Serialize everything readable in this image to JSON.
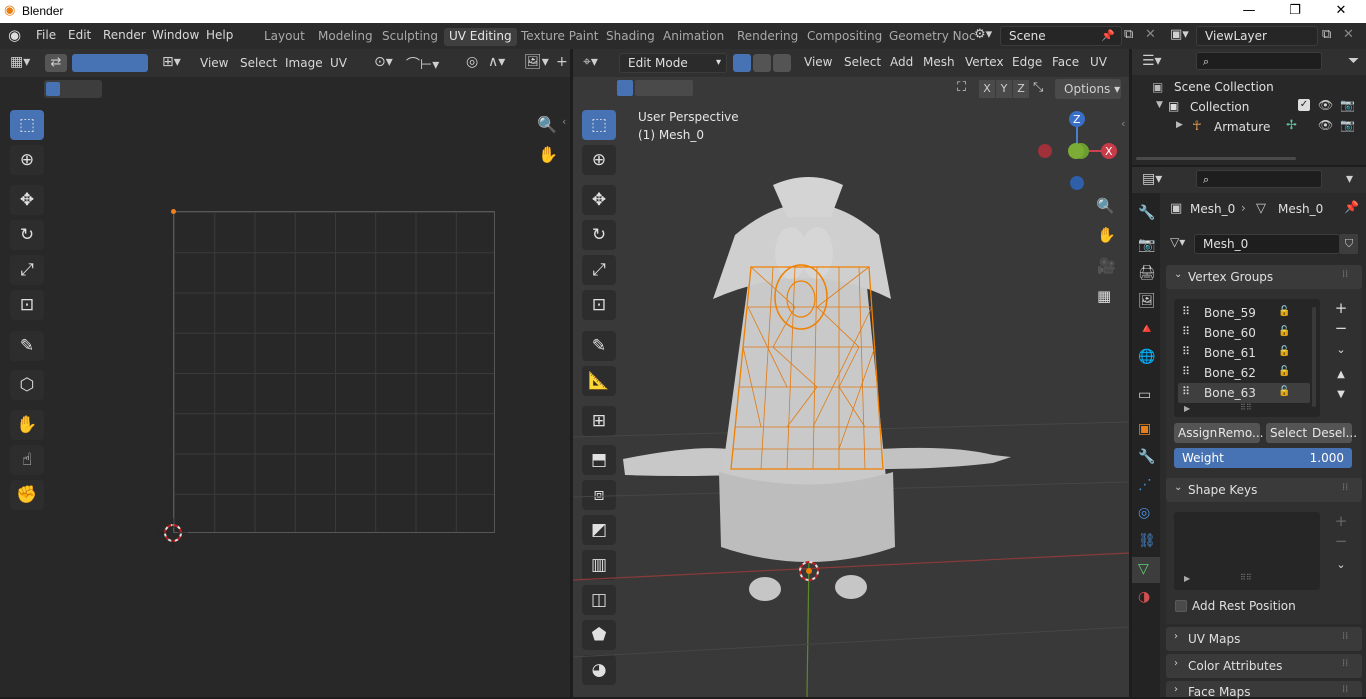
{
  "titlebar": {
    "app": "Blender"
  },
  "menu": [
    "File",
    "Edit",
    "Render",
    "Window",
    "Help"
  ],
  "workspaces": [
    "Layout",
    "Modeling",
    "Sculpting",
    "UV Editing",
    "Texture Paint",
    "Shading",
    "Animation",
    "Rendering",
    "Compositing",
    "Geometry Noc"
  ],
  "scene": {
    "name": "Scene",
    "view_layer": "ViewLayer"
  },
  "uv_editor": {
    "menus": [
      "View",
      "Select",
      "Image",
      "UV"
    ]
  },
  "viewport": {
    "mode": "Edit Mode",
    "menus": [
      "View",
      "Select",
      "Add",
      "Mesh",
      "Vertex",
      "Edge",
      "Face",
      "UV"
    ],
    "options_label": "Options",
    "overlay_title": "User Perspective",
    "overlay_object": "(1) Mesh_0",
    "axes": [
      "X",
      "Y",
      "Z"
    ],
    "gizmo": {
      "z": "Z",
      "y": "Y",
      "x": "X"
    }
  },
  "outliner": {
    "scene_collection": "Scene Collection",
    "collection": "Collection",
    "armature": "Armature"
  },
  "properties": {
    "breadcrumb": {
      "object": "Mesh_0",
      "data": "Mesh_0"
    },
    "mesh_name": "Mesh_0",
    "vertex_groups": {
      "title": "Vertex Groups",
      "items": [
        "Bone_59",
        "Bone_60",
        "Bone_61",
        "Bone_62",
        "Bone_63"
      ],
      "assign": "Assign",
      "remove": "Remo...",
      "select": "Select",
      "deselect": "Desel...",
      "weight_label": "Weight",
      "weight_value": "1.000"
    },
    "shape_keys": {
      "title": "Shape Keys",
      "add_rest": "Add Rest Position"
    },
    "panels": [
      "UV Maps",
      "Color Attributes",
      "Face Maps"
    ]
  }
}
